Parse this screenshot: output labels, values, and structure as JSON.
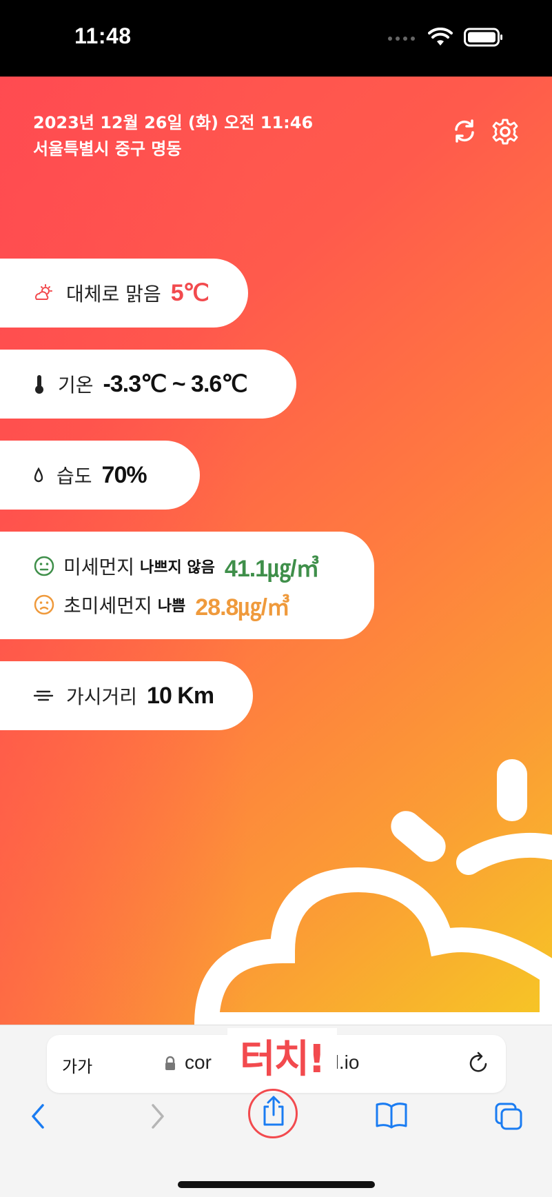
{
  "status_bar": {
    "time": "11:48"
  },
  "header": {
    "datetime": "2023년 12월 26일 (화) 오전 11:46",
    "location": "서울특별시 중구 명동"
  },
  "weather": {
    "condition_label": "대체로 맑음",
    "current_temp": "5℃",
    "temp_label": "기온",
    "temp_range": "-3.3℃ ~ 3.6℃",
    "humidity_label": "습도",
    "humidity": "70%",
    "pm10_label": "미세먼지",
    "pm10_status": "나쁘지 않음",
    "pm10_value": "41.1㎍/㎥",
    "pm25_label": "초미세먼지",
    "pm25_status": "나쁨",
    "pm25_value": "28.8㎍/㎥",
    "visibility_label": "가시거리",
    "visibility": "10 Km"
  },
  "colors": {
    "accent_red": "#f24a4e",
    "good_green": "#3f8f4a",
    "bad_orange": "#ef9a3c",
    "ios_blue": "#1a7cf2"
  },
  "browser": {
    "text_size_button": "가가",
    "url_prefix": "cor",
    "url_suffix": "stud.io",
    "overlay_text": "터치!"
  },
  "icons": {
    "header": [
      "refresh-icon",
      "settings-icon"
    ],
    "toolbar": [
      "back-icon",
      "forward-icon",
      "share-icon",
      "bookmarks-icon",
      "tabs-icon"
    ]
  }
}
